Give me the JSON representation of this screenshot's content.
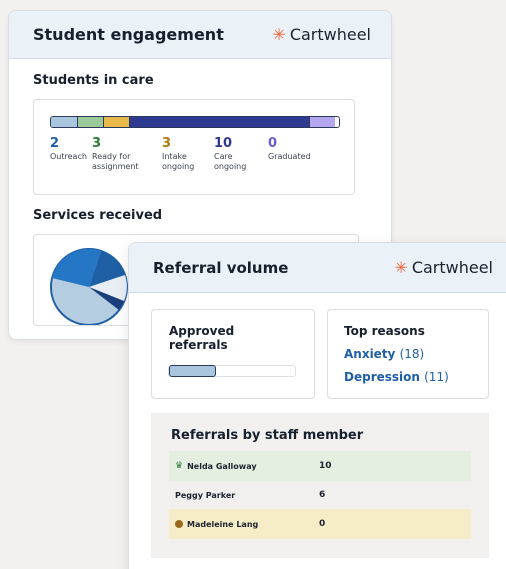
{
  "engagement_card": {
    "title": "Student engagement",
    "brand": "Cartwheel",
    "students_in_care": {
      "title": "Students in care",
      "segments": [
        {
          "label": "Outreach",
          "count": "2",
          "color": "#a9c6de",
          "num_color": "#1f5fa6"
        },
        {
          "label": "Ready for assignment",
          "count": "3",
          "color": "#9cc99a",
          "num_color": "#2f7d3a"
        },
        {
          "label": "Intake ongoing",
          "count": "3",
          "color": "#e6b94a",
          "num_color": "#b07a10"
        },
        {
          "label": "Care ongoing",
          "count": "10",
          "color": "#2e3a8f",
          "num_color": "#2e3a8f"
        },
        {
          "label": "Graduated",
          "count": "0",
          "color": "#b6a6f0",
          "num_color": "#6f57d8"
        }
      ],
      "stats": [
        {
          "num": "2",
          "line1": "Outreach",
          "line2": ""
        },
        {
          "num": "3",
          "line1": "Ready for",
          "line2": "assignment"
        },
        {
          "num": "3",
          "line1": "Intake",
          "line2": "ongoing"
        },
        {
          "num": "10",
          "line1": "Care",
          "line2": "ongoing"
        },
        {
          "num": "0",
          "line1": "Graduated",
          "line2": ""
        }
      ]
    },
    "services_received": {
      "title": "Services received"
    }
  },
  "referral_card": {
    "title": "Referral volume",
    "brand": "Cartwheel",
    "approved": {
      "title_line1": "Approved",
      "title_line2": "referrals",
      "fill_fraction": 0.37
    },
    "top_reasons": {
      "title": "Top reasons",
      "items": [
        {
          "label": "Anxiety",
          "count": "(18)"
        },
        {
          "label": "Depression",
          "count": "(11)"
        }
      ]
    },
    "staff": {
      "title": "Referrals by staff member",
      "rows": [
        {
          "name": "Nelda Galloway",
          "value": "10",
          "badge": "crown-icon",
          "bg": "#e4efe2"
        },
        {
          "name": "Peggy Parker",
          "value": "6",
          "badge": "",
          "bg": "#f1f0ee"
        },
        {
          "name": "Madeleine Lang",
          "value": "0",
          "badge": "dot-icon",
          "bg": "#f7ecc8"
        }
      ]
    }
  }
}
